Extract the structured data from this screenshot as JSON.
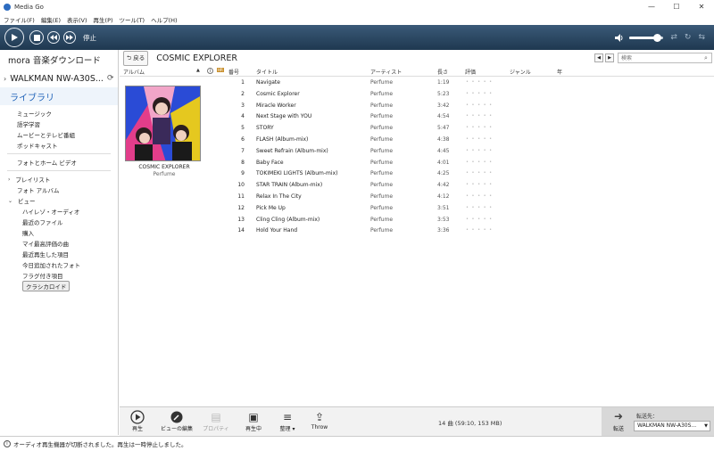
{
  "window": {
    "title": "Media Go",
    "controls": [
      "—",
      "☐",
      "✕"
    ]
  },
  "menu": [
    "ファイル(F)",
    "編集(E)",
    "表示(V)",
    "再生(P)",
    "ツール(T)",
    "ヘルプ(H)"
  ],
  "player": {
    "status": "停止",
    "volume_fraction": 0.8
  },
  "sidebar": {
    "mora": "mora 音楽ダウンロード",
    "device": "WALKMAN NW-A30S...",
    "library": "ライブラリ",
    "media_items": [
      "ミュージック",
      "語学学習",
      "ムービーとテレビ番組",
      "ポッドキャスト"
    ],
    "photo_video": "フォトとホーム ビデオ",
    "playlist": "プレイリスト",
    "photo_album": "フォト アルバム",
    "view": "ビュー",
    "view_items": [
      "ハイレゾ・オーディオ",
      "最近のファイル",
      "購入",
      "マイ最高評価の曲",
      "最近再生した項目",
      "今日追加されたフォト",
      "フラグ付き項目"
    ],
    "selected_view": "クラシカロイド"
  },
  "header": {
    "back_label": "戻る",
    "album_title": "COSMIC EXPLORER",
    "search_placeholder": "検索"
  },
  "columns": {
    "album": "アルバム",
    "number": "番号",
    "title": "タイトル",
    "artist": "アーティスト",
    "length": "長さ",
    "rating": "評価",
    "genre": "ジャンル",
    "year": "年"
  },
  "album": {
    "name": "COSMIC EXPLORER",
    "artist": "Perfume"
  },
  "tracks": [
    {
      "num": "1",
      "title": "Navigate",
      "artist": "Perfume",
      "length": "1:19"
    },
    {
      "num": "2",
      "title": "Cosmic Explorer",
      "artist": "Perfume",
      "length": "5:23"
    },
    {
      "num": "3",
      "title": "Miracle Worker",
      "artist": "Perfume",
      "length": "3:42"
    },
    {
      "num": "4",
      "title": "Next Stage with YOU",
      "artist": "Perfume",
      "length": "4:54"
    },
    {
      "num": "5",
      "title": "STORY",
      "artist": "Perfume",
      "length": "5:47"
    },
    {
      "num": "6",
      "title": "FLASH (Album-mix)",
      "artist": "Perfume",
      "length": "4:38"
    },
    {
      "num": "7",
      "title": "Sweet Refrain (Album-mix)",
      "artist": "Perfume",
      "length": "4:45"
    },
    {
      "num": "8",
      "title": "Baby Face",
      "artist": "Perfume",
      "length": "4:01"
    },
    {
      "num": "9",
      "title": "TOKIMEKI LIGHTS (Album-mix)",
      "artist": "Perfume",
      "length": "4:25"
    },
    {
      "num": "10",
      "title": "STAR TRAIN (Album-mix)",
      "artist": "Perfume",
      "length": "4:42"
    },
    {
      "num": "11",
      "title": "Relax In The City",
      "artist": "Perfume",
      "length": "4:12"
    },
    {
      "num": "12",
      "title": "Pick Me Up",
      "artist": "Perfume",
      "length": "3:51"
    },
    {
      "num": "13",
      "title": "Cling Cling (Album-mix)",
      "artist": "Perfume",
      "length": "3:53"
    },
    {
      "num": "14",
      "title": "Hold Your Hand",
      "artist": "Perfume",
      "length": "3:36"
    }
  ],
  "toolbar": {
    "play": "再生",
    "edit_view": "ビューの編集",
    "properties": "プロパティ",
    "now_playing": "再生中",
    "organize": "整理 ▾",
    "throw": "Throw",
    "count": "14 曲 (59:10, 153 MB)",
    "send": "転送",
    "dest_label": "転送先：",
    "dest_value": "WALKMAN NW-A30S..."
  },
  "statusbar": {
    "message": "オーディオ再生機器が切断されました。再生は一時停止しました。"
  },
  "colors": {
    "transport_bg": "#2b4a68",
    "library_blue": "#1f62b8",
    "album_art_blue": "#2a4bd6"
  }
}
